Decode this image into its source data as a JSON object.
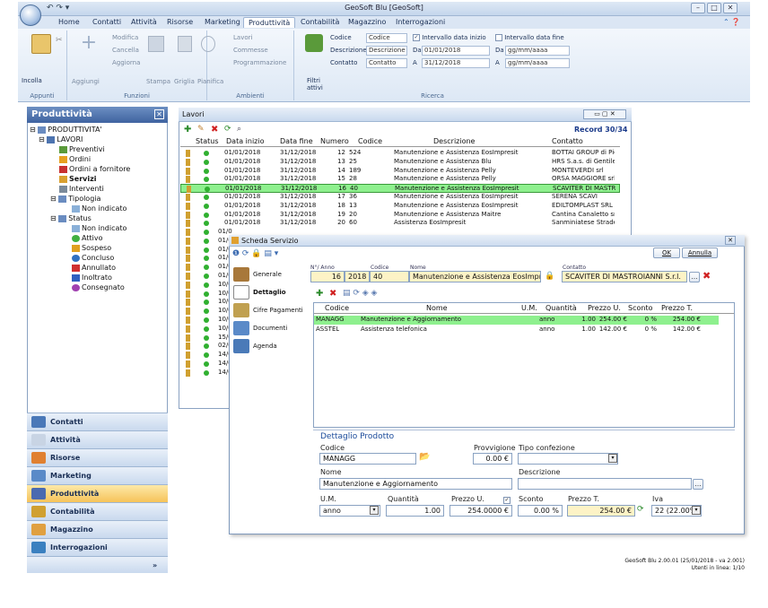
{
  "app": {
    "title": "GeoSoft Blu [GeoSoft]"
  },
  "menu": [
    "Home",
    "Contatti",
    "Attività",
    "Risorse",
    "Marketing",
    "Produttività",
    "Contabilità",
    "Magazzino",
    "Interrogazioni"
  ],
  "ribbon": {
    "incolla": "Incolla",
    "aggiungi": "Aggiungi",
    "modifica": "Modifica",
    "cancella": "Cancella",
    "aggiorna": "Aggiorna",
    "stampa": "Stampa",
    "griglia": "Griglia",
    "pianifica": "Pianifica",
    "lavori": "Lavori",
    "commesse": "Commesse",
    "programmazione": "Programmazione",
    "filtri": "Filtri",
    "attivi": "attivi",
    "codice_label": "Codice",
    "codice_ph": "Codice",
    "descrizione_label": "Descrizione",
    "descrizione_ph": "Descrizione",
    "contatto_label": "Contatto",
    "contatto_ph": "Contatto",
    "intervallo_inizio": "Intervallo data inizio",
    "da": "Da",
    "a": "A",
    "inizio_da": "01/01/2018",
    "inizio_a": "31/12/2018",
    "intervallo_fine": "Intervallo data fine",
    "fine_da": "gg/mm/aaaa",
    "fine_a": "gg/mm/aaaa",
    "groups": {
      "appunti": "Appunti",
      "funzioni": "Funzioni",
      "ambienti": "Ambienti",
      "ricerca": "Ricerca"
    }
  },
  "left": {
    "title": "Produttività",
    "tree": [
      "PRODUTTIVITA'",
      "LAVORI",
      "Preventivi",
      "Ordini",
      "Ordini a fornitore",
      "Servizi",
      "Interventi",
      "Tipologia",
      "Non indicato",
      "Status",
      "Non indicato",
      "Attivo",
      "Sospeso",
      "Concluso",
      "Annullato",
      "Inoltrato",
      "Consegnato"
    ],
    "nav": [
      "Contatti",
      "Attività",
      "Risorse",
      "Marketing",
      "Produttività",
      "Contabilità",
      "Magazzino",
      "Interrogazioni"
    ]
  },
  "lavori": {
    "title": "Lavori",
    "record": "Record 30/34",
    "headers": [
      "Status",
      "Data inizio",
      "Data fine",
      "Numero",
      "Codice",
      "Descrizione",
      "Contatto"
    ],
    "rows": [
      [
        "01/01/2018",
        "31/12/2018",
        "12",
        "524",
        "Manutenzione e Assistenza EosImpresit",
        "BOTTAI GROUP di Pierluigi Bottai &"
      ],
      [
        "01/01/2018",
        "31/12/2018",
        "13",
        "25",
        "Manutenzione e Assistenza Blu",
        "HRS S.a.s. di Gentile Paolo & C."
      ],
      [
        "01/01/2018",
        "31/12/2018",
        "14",
        "189",
        "Manutenzione e Assistenza Pelly",
        "MONTEVERDI srl"
      ],
      [
        "01/01/2018",
        "31/12/2018",
        "15",
        "28",
        "Manutenzione e Assistenza Pelly",
        "ORSA MAGGIORE srl"
      ],
      [
        "01/01/2018",
        "31/12/2018",
        "16",
        "40",
        "Manutenzione e Assistenza EosImpresit",
        "SCAVITER DI MASTROIANNI S.r.l."
      ],
      [
        "01/01/2018",
        "31/12/2018",
        "17",
        "36",
        "Manutenzione e Assistenza EosImpresit",
        "SERENA SCAVI"
      ],
      [
        "01/01/2018",
        "31/12/2018",
        "18",
        "13",
        "Manutenzione e Assistenza EosImpresit",
        "EDILTOMPLAST SRL"
      ],
      [
        "01/01/2018",
        "31/12/2018",
        "19",
        "20",
        "Manutenzione e Assistenza Maitre",
        "Cantina Canaletto srl"
      ],
      [
        "01/01/2018",
        "31/12/2018",
        "20",
        "60",
        "Assistenza EosImpresit",
        "Sanminiatese Strade s.r.l."
      ]
    ],
    "partial_dates": [
      "01/0",
      "01/0",
      "01/0",
      "01/0",
      "01/0",
      "01/0",
      "10/0",
      "10/0",
      "10/0",
      "10/0",
      "10/0",
      "10/0",
      "15/0",
      "02/0",
      "14/0",
      "14/0",
      "14/0"
    ]
  },
  "scheda": {
    "title": "Scheda Servizio",
    "ok": "OK",
    "annulla": "Annulla",
    "side": [
      "Generale",
      "Dettaglio",
      "Cifre Pagamenti",
      "Documenti",
      "Agenda"
    ],
    "lbl_anno": "N°/ Anno",
    "lbl_codice": "Codice",
    "lbl_nome": "Nome",
    "lbl_contatto": "Contatto",
    "numero": "16",
    "anno": "2018",
    "codice": "40",
    "nome": "Manutenzione e Assistenza EosImpresit",
    "contatto": "SCAVITER DI MASTROIANNI S.r.l.",
    "headers": [
      "Codice",
      "Nome",
      "U.M.",
      "Quantità",
      "Prezzo U.",
      "Sconto",
      "Prezzo T."
    ],
    "rows": [
      [
        "MANAGG",
        "Manutenzione e Aggiornamento",
        "anno",
        "1.00",
        "254.00 €",
        "0 %",
        "254.00 €"
      ],
      [
        "ASSTEL",
        "Assistenza telefonica",
        "anno",
        "1.00",
        "142.00 €",
        "0 %",
        "142.00 €"
      ]
    ],
    "det": {
      "title": "Dettaglio Prodotto",
      "codice_l": "Codice",
      "codice": "MANAGG",
      "provvigione_l": "Provvigione",
      "provvigione": "0.00 €",
      "tipo_l": "Tipo confezione",
      "nome_l": "Nome",
      "nome": "Manutenzione e Aggiornamento",
      "descrizione_l": "Descrizione",
      "um_l": "U.M.",
      "um": "anno",
      "quantita_l": "Quantità",
      "quantita": "1.00",
      "prezzou_l": "Prezzo U.",
      "prezzou": "254.0000 €",
      "sconto_l": "Sconto",
      "sconto": "0.00 %",
      "prezzot_l": "Prezzo T.",
      "prezzot": "254.00 €",
      "iva_l": "Iva",
      "iva": "22 (22.00%)"
    }
  },
  "footer": {
    "version": "GeoSoft Blu 2.00.01 (25/01/2018 - va 2.001)",
    "users": "Utenti in linea: 1/10"
  }
}
